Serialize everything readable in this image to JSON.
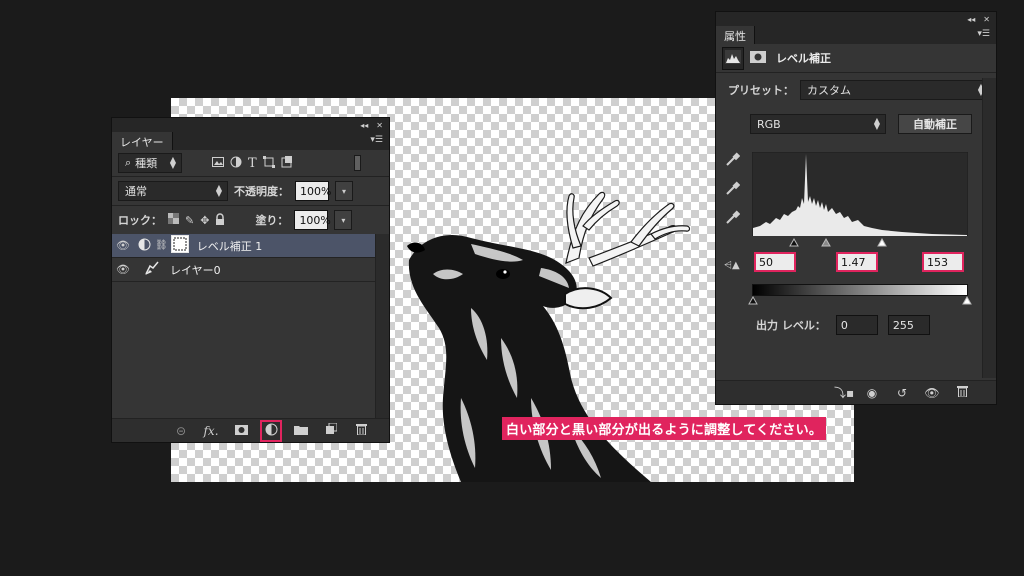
{
  "instruction": "白い部分と黒い部分が出るように調整してください。",
  "layers_panel": {
    "tab": "レイヤー",
    "filter_kind": "種類",
    "blend_mode": "通常",
    "opacity_label": "不透明度：",
    "opacity_value": "100%",
    "lock_label": "ロック：",
    "fill_label": "塗り：",
    "fill_value": "100%",
    "layers": [
      {
        "name": "レベル補正 1",
        "selected": true
      },
      {
        "name": "レイヤー0",
        "selected": false
      }
    ]
  },
  "properties_panel": {
    "tab": "属性",
    "title": "レベル補正",
    "preset_label": "プリセット：",
    "preset_value": "カスタム",
    "channel": "RGB",
    "auto_button": "自動補正",
    "input_black": "50",
    "input_gamma": "1.47",
    "input_white": "153",
    "output_label": "出力 レベル：",
    "output_black": "0",
    "output_white": "255"
  },
  "colors": {
    "accent": "#e0245e",
    "panel_bg": "#353535",
    "selected_layer": "#4c5468"
  }
}
